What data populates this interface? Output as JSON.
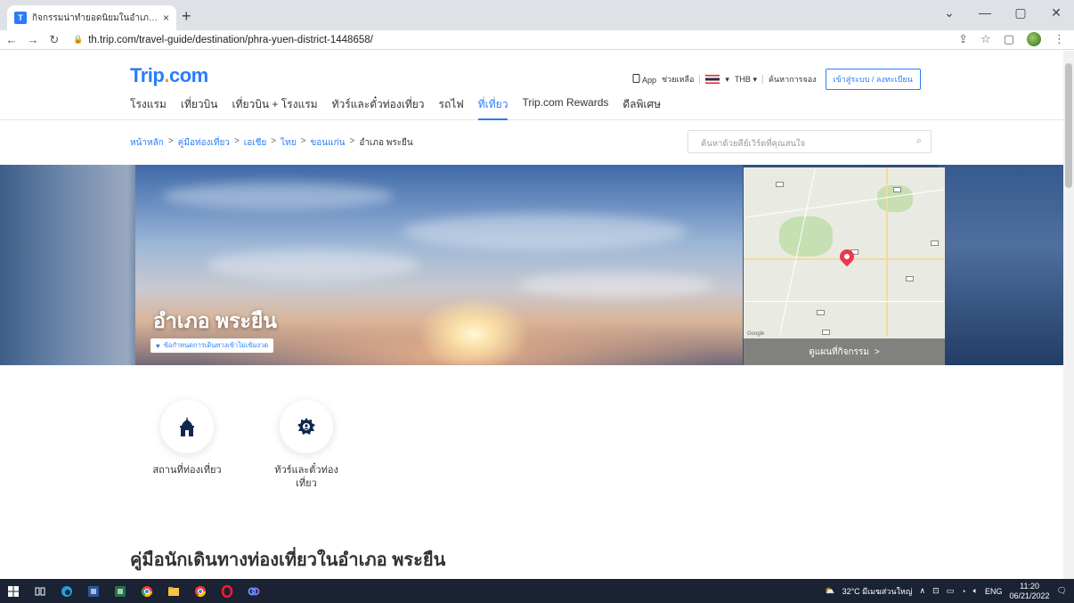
{
  "browser": {
    "tab_title": "กิจกรรมน่าทำยอดนิยมในอำเภอ พระยืน",
    "tab_close": "×",
    "new_tab": "+",
    "url": "th.trip.com/travel-guide/destination/phra-yuen-district-1448658/",
    "win_minimize": "—",
    "win_maximize": "▢",
    "win_close": "✕",
    "win_dropdown": "⌄"
  },
  "header": {
    "logo_main": "Trip",
    "logo_dot": ".",
    "logo_tail": "com",
    "app": "App",
    "help": "ช่วยเหลือ",
    "currency": "THB ▾",
    "search_booking": "ค้นหาการจอง",
    "login": "เข้าสู่ระบบ / ลงทะเบียน"
  },
  "nav": {
    "items": [
      "โรงแรม",
      "เที่ยวบิน",
      "เที่ยวบิน + โรงแรม",
      "ทัวร์และตั๋วท่องเที่ยว",
      "รถไฟ",
      "ที่เที่ยว",
      "Trip.com Rewards",
      "ดีลพิเศษ"
    ],
    "active_index": 5
  },
  "breadcrumb": {
    "items": [
      "หน้าหลัก",
      "คู่มือท่องเที่ยว",
      "เอเชีย",
      "ไทย",
      "ขอนแก่น"
    ],
    "current": "อำเภอ พระยืน",
    "sep": ">"
  },
  "search": {
    "placeholder": "ค้นหาด้วยคีย์เวิร์ดที่คุณสนใจ"
  },
  "hero": {
    "title": "อำเภอ พระยืน",
    "tag": "ข้อกำหนดการเดินทางเข้าไม่เข้มงวด"
  },
  "map": {
    "link": "ดูแผนที่กิจกรรม",
    "arrow": ">",
    "attribution": "Google"
  },
  "categories": [
    {
      "label": "สถานที่ท่องเที่ยว",
      "icon": "temple-icon"
    },
    {
      "label": "ทัวร์และตั๋วท่องเที่ยว",
      "icon": "tour-icon"
    }
  ],
  "guide": {
    "title": "คู่มือนักเดินทางท่องเที่ยวในอำเภอ พระยืน"
  },
  "taskbar": {
    "weather": "32°C มีเมฆส่วนใหญ่",
    "lang": "ENG",
    "time": "11:20",
    "date": "06/21/2022"
  },
  "colors": {
    "brand": "#287dfa",
    "accent": "#ff9500",
    "pin": "#e8394f"
  }
}
